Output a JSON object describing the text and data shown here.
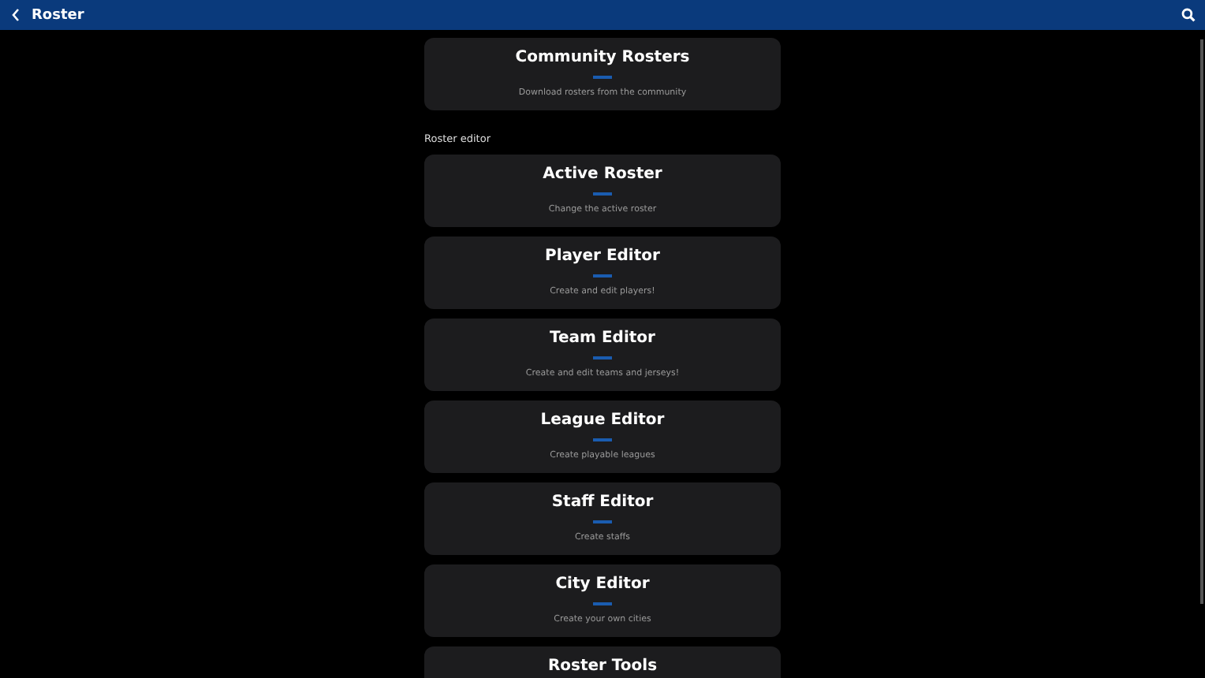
{
  "header": {
    "title": "Roster"
  },
  "top_cards": [
    {
      "title": "Community Rosters",
      "subtitle": "Download rosters from the community"
    }
  ],
  "section": {
    "label": "Roster editor",
    "cards": [
      {
        "title": "Active Roster",
        "subtitle": "Change the active roster"
      },
      {
        "title": "Player Editor",
        "subtitle": "Create and edit players!"
      },
      {
        "title": "Team Editor",
        "subtitle": "Create and edit teams and jerseys!"
      },
      {
        "title": "League Editor",
        "subtitle": "Create playable leagues"
      },
      {
        "title": "Staff Editor",
        "subtitle": "Create staffs"
      },
      {
        "title": "City Editor",
        "subtitle": "Create your own cities"
      },
      {
        "title": "Roster Tools"
      }
    ]
  }
}
